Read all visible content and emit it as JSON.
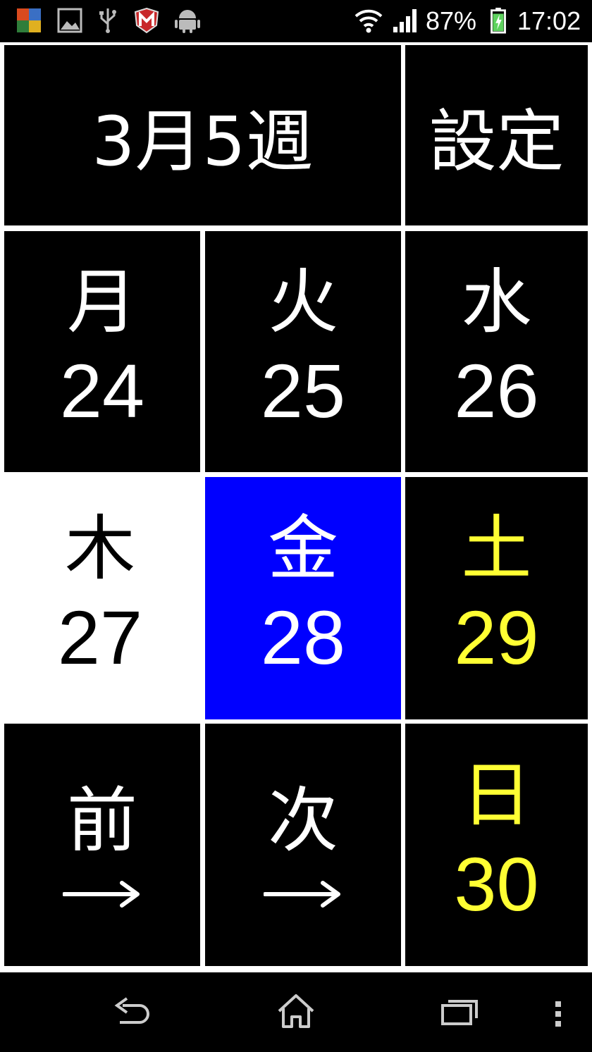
{
  "status": {
    "battery": "87%",
    "time": "17:02",
    "left_icons": [
      "avg-icon",
      "gallery-icon",
      "usb-icon",
      "mcafee-icon",
      "android-debug-icon"
    ],
    "right_icons": [
      "wifi-icon",
      "signal-icon",
      "battery-charging-icon"
    ]
  },
  "header": {
    "title": "3月5週",
    "settings": "設定"
  },
  "days": [
    {
      "day": "月",
      "date": "24"
    },
    {
      "day": "火",
      "date": "25"
    },
    {
      "day": "水",
      "date": "26"
    },
    {
      "day": "木",
      "date": "27"
    },
    {
      "day": "金",
      "date": "28"
    },
    {
      "day": "土",
      "date": "29"
    },
    {
      "day": "日",
      "date": "30"
    }
  ],
  "nav": {
    "prev": "前",
    "next": "次"
  },
  "colors": {
    "today_bg": "#0000ff",
    "weekend": "#ffff33",
    "selected_bg": "#ffffff"
  },
  "system_nav": [
    "back-icon",
    "home-icon",
    "recent-apps-icon",
    "menu-icon"
  ]
}
